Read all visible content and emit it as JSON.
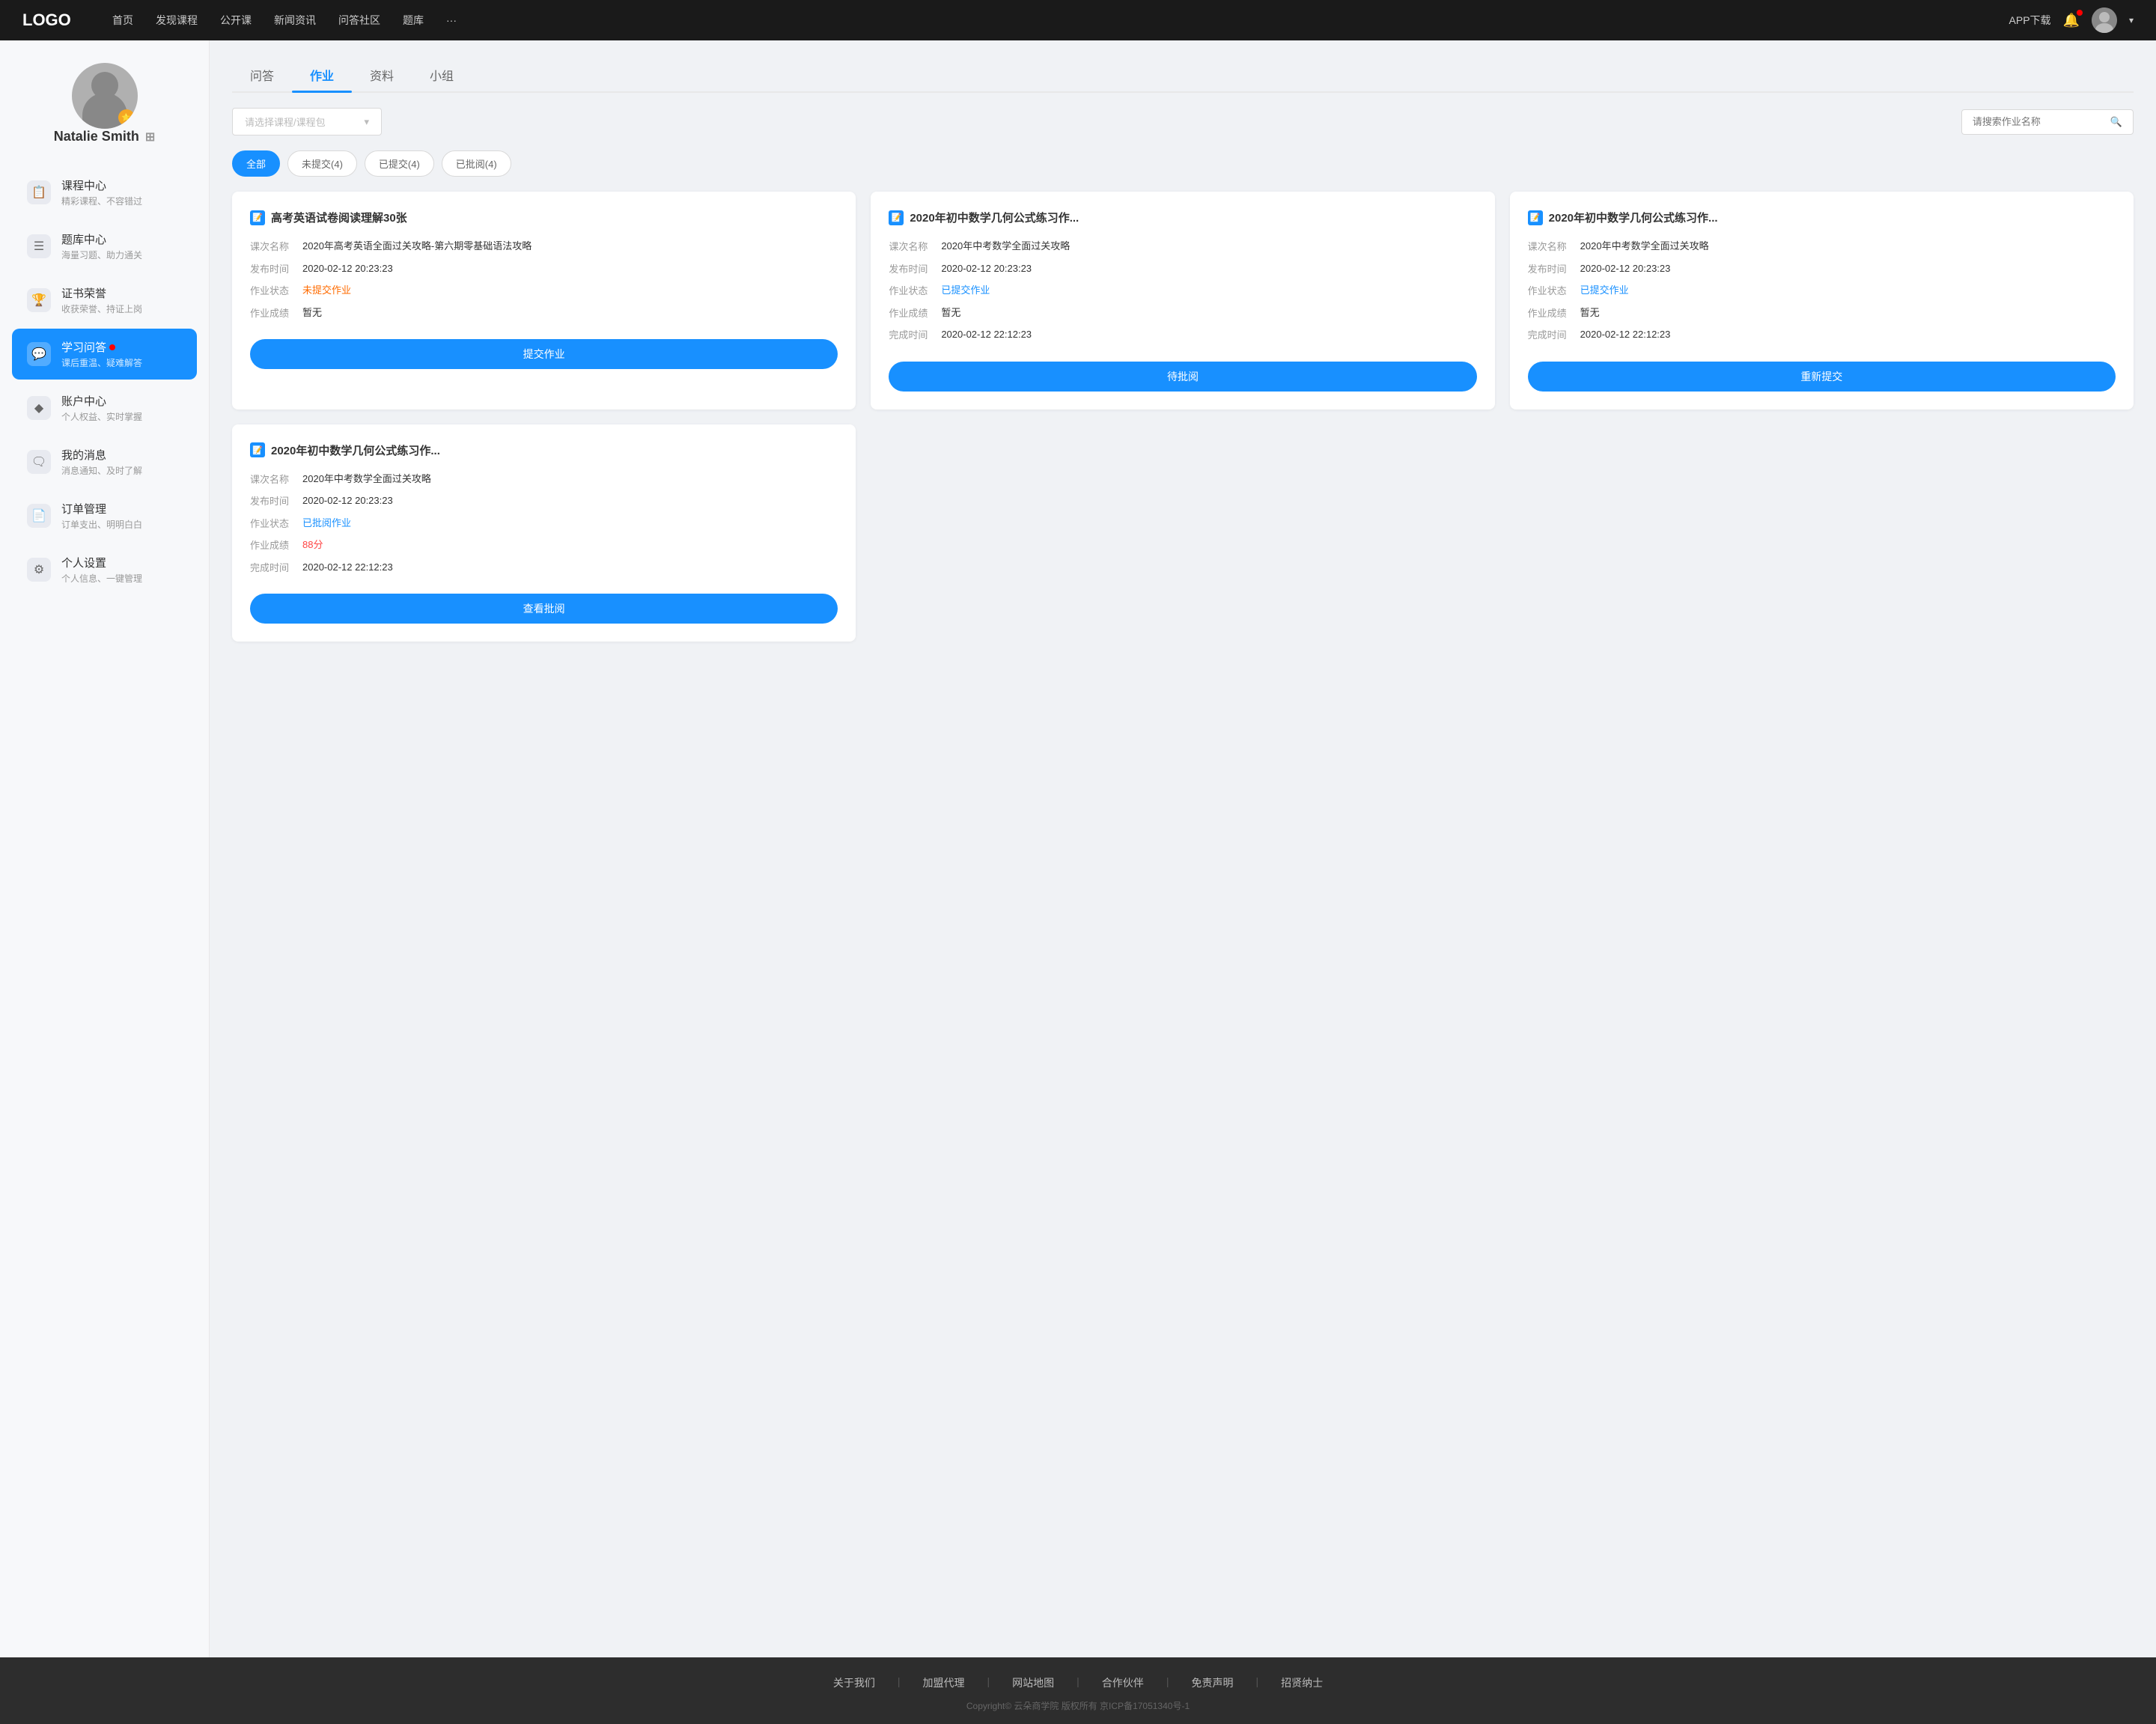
{
  "header": {
    "logo": "LOGO",
    "nav": [
      {
        "label": "首页"
      },
      {
        "label": "发现课程"
      },
      {
        "label": "公开课"
      },
      {
        "label": "新闻资讯"
      },
      {
        "label": "问答社区"
      },
      {
        "label": "题库"
      },
      {
        "label": "···"
      }
    ],
    "download": "APP下载",
    "chevron": "▾"
  },
  "sidebar": {
    "profile": {
      "name": "Natalie Smith",
      "vip_icon": "VIP"
    },
    "nav_items": [
      {
        "id": "course",
        "icon": "📋",
        "title": "课程中心",
        "subtitle": "精彩课程、不容错过"
      },
      {
        "id": "question-bank",
        "icon": "☰",
        "title": "题库中心",
        "subtitle": "海量习题、助力通关"
      },
      {
        "id": "certificate",
        "icon": "⚙",
        "title": "证书荣誉",
        "subtitle": "收获荣誉、持证上岗"
      },
      {
        "id": "qa",
        "icon": "💬",
        "title": "学习问答",
        "subtitle": "课后重温、疑难解答",
        "active": true,
        "dot": true
      },
      {
        "id": "account",
        "icon": "♦",
        "title": "账户中心",
        "subtitle": "个人权益、实时掌握"
      },
      {
        "id": "message",
        "icon": "💬",
        "title": "我的消息",
        "subtitle": "消息通知、及时了解"
      },
      {
        "id": "order",
        "icon": "📄",
        "title": "订单管理",
        "subtitle": "订单支出、明明白白"
      },
      {
        "id": "settings",
        "icon": "⚙",
        "title": "个人设置",
        "subtitle": "个人信息、一键管理"
      }
    ]
  },
  "content": {
    "tabs": [
      {
        "label": "问答"
      },
      {
        "label": "作业",
        "active": true
      },
      {
        "label": "资料"
      },
      {
        "label": "小组"
      }
    ],
    "course_select_placeholder": "请选择课程/课程包",
    "search_placeholder": "请搜索作业名称",
    "status_filters": [
      {
        "label": "全部",
        "active": true
      },
      {
        "label": "未提交(4)"
      },
      {
        "label": "已提交(4)"
      },
      {
        "label": "已批阅(4)"
      }
    ],
    "cards": [
      {
        "id": "card1",
        "title": "高考英语试卷阅读理解30张",
        "course_name_label": "课次名称",
        "course_name_value": "2020年高考英语全面过关攻略-第六期零基础语法攻略",
        "publish_time_label": "发布时间",
        "publish_time_value": "2020-02-12 20:23:23",
        "status_label": "作业状态",
        "status_value": "未提交作业",
        "status_class": "status-unsubmitted",
        "score_label": "作业成绩",
        "score_value": "暂无",
        "finish_time_label": "",
        "finish_time_value": "",
        "btn_label": "提交作业",
        "btn_class": ""
      },
      {
        "id": "card2",
        "title": "2020年初中数学几何公式练习作...",
        "course_name_label": "课次名称",
        "course_name_value": "2020年中考数学全面过关攻略",
        "publish_time_label": "发布时间",
        "publish_time_value": "2020-02-12 20:23:23",
        "status_label": "作业状态",
        "status_value": "已提交作业",
        "status_class": "status-submitted",
        "score_label": "作业成绩",
        "score_value": "暂无",
        "finish_time_label": "完成时间",
        "finish_time_value": "2020-02-12 22:12:23",
        "btn_label": "待批阅",
        "btn_class": ""
      },
      {
        "id": "card3",
        "title": "2020年初中数学几何公式练习作...",
        "course_name_label": "课次名称",
        "course_name_value": "2020年中考数学全面过关攻略",
        "publish_time_label": "发布时间",
        "publish_time_value": "2020-02-12 20:23:23",
        "status_label": "作业状态",
        "status_value": "已提交作业",
        "status_class": "status-submitted",
        "score_label": "作业成绩",
        "score_value": "暂无",
        "finish_time_label": "完成时间",
        "finish_time_value": "2020-02-12 22:12:23",
        "btn_label": "重新提交",
        "btn_class": ""
      },
      {
        "id": "card4",
        "title": "2020年初中数学几何公式练习作...",
        "course_name_label": "课次名称",
        "course_name_value": "2020年中考数学全面过关攻略",
        "publish_time_label": "发布时间",
        "publish_time_value": "2020-02-12 20:23:23",
        "status_label": "作业状态",
        "status_value": "已批阅作业",
        "status_class": "status-reviewed",
        "score_label": "作业成绩",
        "score_value": "88分",
        "score_class": "score",
        "finish_time_label": "完成时间",
        "finish_time_value": "2020-02-12 22:12:23",
        "btn_label": "查看批阅",
        "btn_class": ""
      }
    ]
  },
  "footer": {
    "links": [
      "关于我们",
      "加盟代理",
      "网站地图",
      "合作伙伴",
      "免责声明",
      "招贤纳士"
    ],
    "copyright": "Copyright© 云朵商学院  版权所有    京ICP备17051340号-1"
  }
}
